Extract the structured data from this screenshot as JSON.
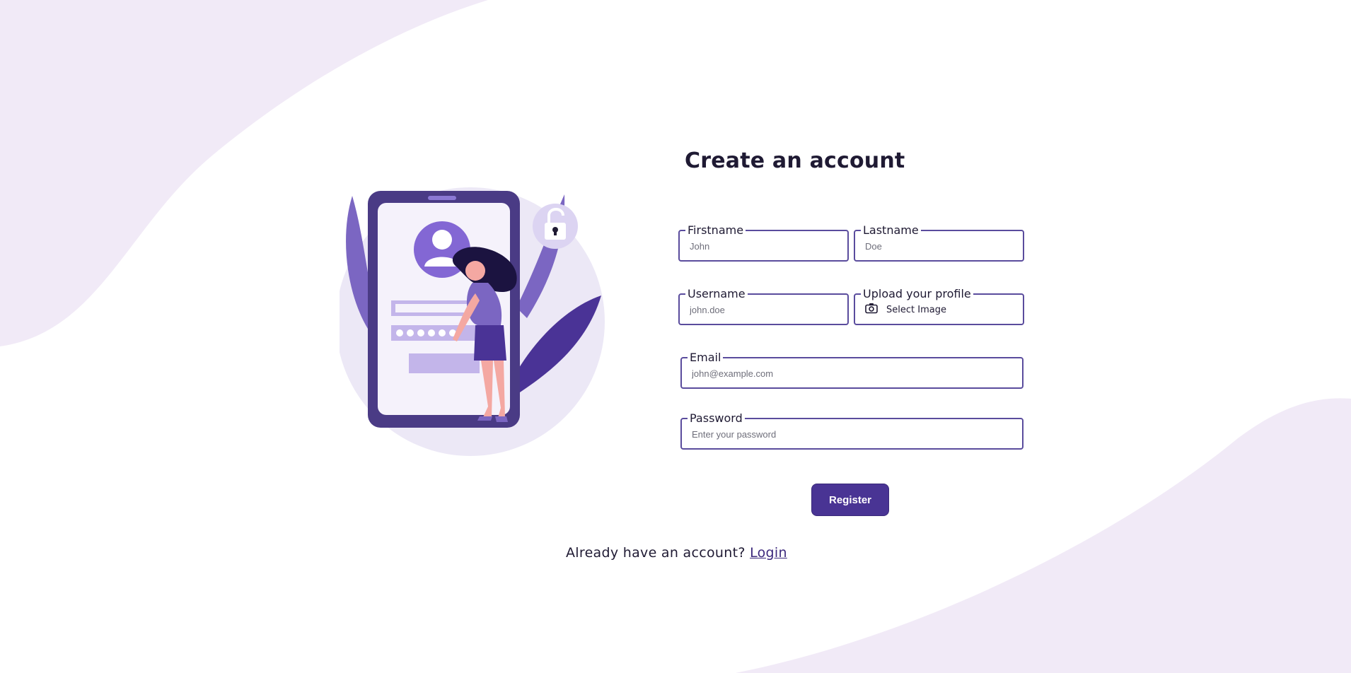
{
  "header": {
    "title": "Create an account"
  },
  "form": {
    "firstname": {
      "label": "Firstname",
      "placeholder": "John",
      "value": ""
    },
    "lastname": {
      "label": "Lastname",
      "placeholder": "Doe",
      "value": ""
    },
    "username": {
      "label": "Username",
      "placeholder": "john.doe",
      "value": ""
    },
    "profile": {
      "label": "Upload your profile",
      "button_text": "Select Image",
      "icon": "camera-icon"
    },
    "email": {
      "label": "Email",
      "placeholder": "john@example.com",
      "value": ""
    },
    "password": {
      "label": "Password",
      "placeholder": "Enter your password",
      "value": ""
    },
    "submit_label": "Register"
  },
  "footer": {
    "prompt": "Already have an account?",
    "login_link": "Login"
  },
  "colors": {
    "accent": "#493494",
    "field_border": "#5a4c9d",
    "blob": "#efe9f6",
    "text": "#1f1a33"
  }
}
